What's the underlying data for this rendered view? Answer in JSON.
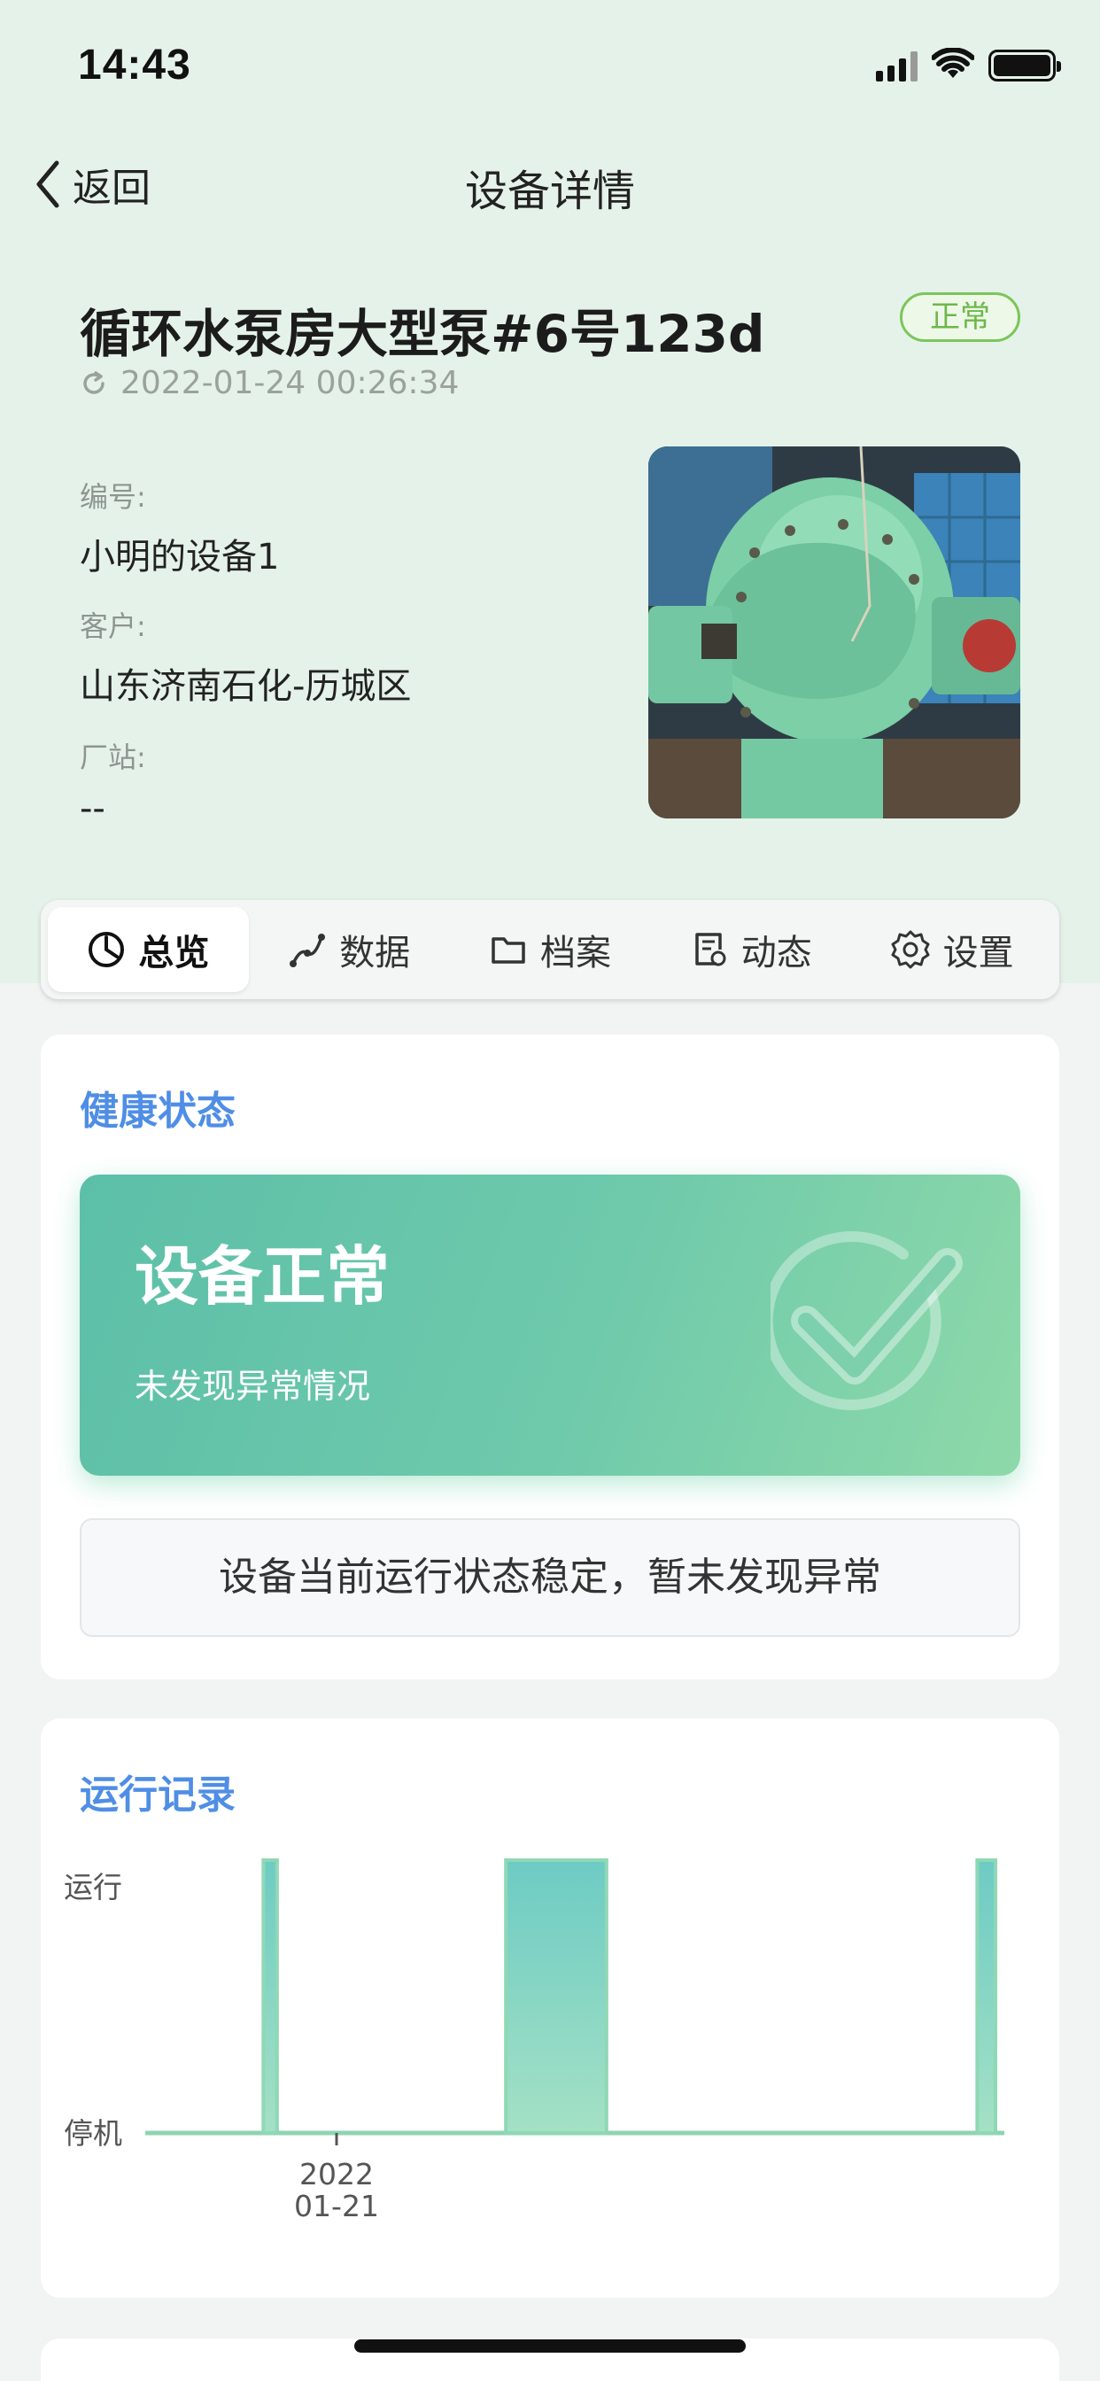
{
  "status_bar": {
    "time": "14:43"
  },
  "nav": {
    "back_label": "返回",
    "title": "设备详情"
  },
  "device": {
    "name": "循环水泵房大型泵#6号123d",
    "status": "正常",
    "updated_at": "2022-01-24 00:26:34",
    "fields": [
      {
        "label": "编号:",
        "value": "小明的设备1"
      },
      {
        "label": "客户:",
        "value": "山东济南石化-历城区"
      },
      {
        "label": "厂站:",
        "value": "--"
      }
    ]
  },
  "tabs": [
    {
      "label": "总览",
      "icon": "dashboard-icon",
      "active": true
    },
    {
      "label": "数据",
      "icon": "trend-icon"
    },
    {
      "label": "档案",
      "icon": "folder-icon"
    },
    {
      "label": "动态",
      "icon": "log-icon"
    },
    {
      "label": "设置",
      "icon": "gear-icon"
    }
  ],
  "health": {
    "title": "健康状态",
    "headline": "设备正常",
    "subtext": "未发现异常情况",
    "note": "设备当前运行状态稳定，暂未发现异常",
    "icon": "check-circle-icon"
  },
  "colors": {
    "accent": "#4f8ee6",
    "normal": "#6cb84a",
    "health_start": "#5cbfa8",
    "health_end": "#8ed9a9",
    "chart_fill": "#7fd0c0"
  },
  "chart_data": {
    "type": "area",
    "title": "运行记录",
    "xlabel": "",
    "ylabel": "",
    "y_categories": [
      "停机",
      "运行"
    ],
    "x_tick_labels": [
      {
        "x": "2022-01-21 00:00",
        "label": [
          "2022",
          "01-21"
        ]
      }
    ],
    "x_range": [
      "2022-01-20 06:00",
      "2022-01-24 00:00"
    ],
    "series": [
      {
        "values": [
          {
            "start": "2022-01-20 16:00",
            "end": "2022-01-20 17:30",
            "state": "运行"
          },
          {
            "start": "2022-01-21 18:30",
            "end": "2022-01-22 05:30",
            "state": "运行"
          },
          {
            "start": "2022-01-23 22:00",
            "end": "2022-01-24 00:00",
            "state": "运行"
          }
        ]
      }
    ],
    "grid": false,
    "legend": "none"
  }
}
